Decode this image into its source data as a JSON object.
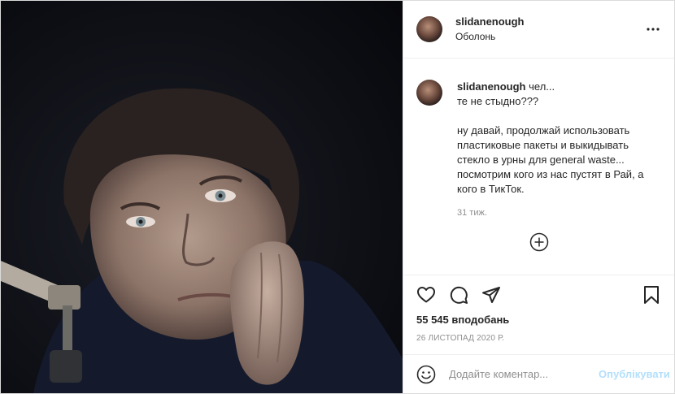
{
  "post": {
    "author": "slidanenough",
    "location": "Оболонь"
  },
  "icons": {
    "more": "more-horizontal-icon",
    "like": "heart-icon",
    "comment": "comment-bubble-icon",
    "share": "paper-plane-icon",
    "save": "bookmark-icon",
    "load_more": "plus-circle-icon",
    "emoji": "emoji-smile-icon"
  },
  "caption": {
    "username": "slidanenough",
    "text": "чел...\nте не стыдно???\n\nну давай, продолжай использовать пластиковые пакеты и выкидывать стекло в урны для general waste... посмотрим кого из нас пустят в Рай, а кого в ТикТок.",
    "time_ago": "31 тиж."
  },
  "stats": {
    "likes": "55 545 вподобань",
    "date": "26 ЛИСТОПАД 2020 Р."
  },
  "comment_box": {
    "placeholder": "Додайте коментар...",
    "value": "",
    "publish_label": "Опублікувати"
  },
  "colors": {
    "border": "#dbdbdb",
    "text": "#262626",
    "secondary": "#8e8e8e",
    "publish_disabled": "#b2dffc"
  }
}
